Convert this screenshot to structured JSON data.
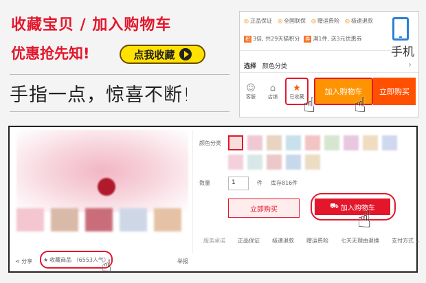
{
  "promo": {
    "title": "收藏宝贝 / 加入购物车",
    "subtitle": "优惠抢先知!",
    "collect_button": "点我收藏",
    "slogan": "手指一点，惊喜不断!"
  },
  "mobile": {
    "guarantees": [
      "正品保证",
      "全国联保",
      "赠运费险",
      "极速退款"
    ],
    "promos": [
      {
        "tag": "",
        "text": "3倍, 共29天猫积分"
      },
      {
        "tag": "",
        "text": "满1件, 送3元优惠券"
      }
    ],
    "device_label": "手机",
    "select_label": "选择",
    "select_value": "颜色分类",
    "chevron": "›",
    "tabbar": {
      "service": "客服",
      "shop": "店铺",
      "collected": "已收藏"
    },
    "add_to_cart": "加入购物车",
    "buy_now": "立即购买"
  },
  "desktop": {
    "color_label": "颜色分类",
    "quantity_label": "数量",
    "quantity_value": "1",
    "unit": "件",
    "stock": "库存816件",
    "buy_now": "立即购买",
    "add_to_cart": "加入购物车",
    "services_label": "服务承诺",
    "services": [
      "正品保证",
      "极速退款",
      "赠运费险",
      "七天无理由退换"
    ],
    "payment": "支付方式",
    "share": "分享",
    "favorite": "收藏商品 （6553人气）",
    "report": "举报"
  },
  "icons": {
    "play": "play-icon",
    "phone": "phone-icon",
    "star": "star-icon",
    "hand": "hand-pointer-icon",
    "cart": "cart-icon"
  },
  "colors": {
    "brand_red": "#e4162b",
    "accent_yellow": "#ffe200",
    "cart_orange": "#ff9402",
    "buy_orange": "#ff5000",
    "phone_blue": "#2a7fd6"
  }
}
